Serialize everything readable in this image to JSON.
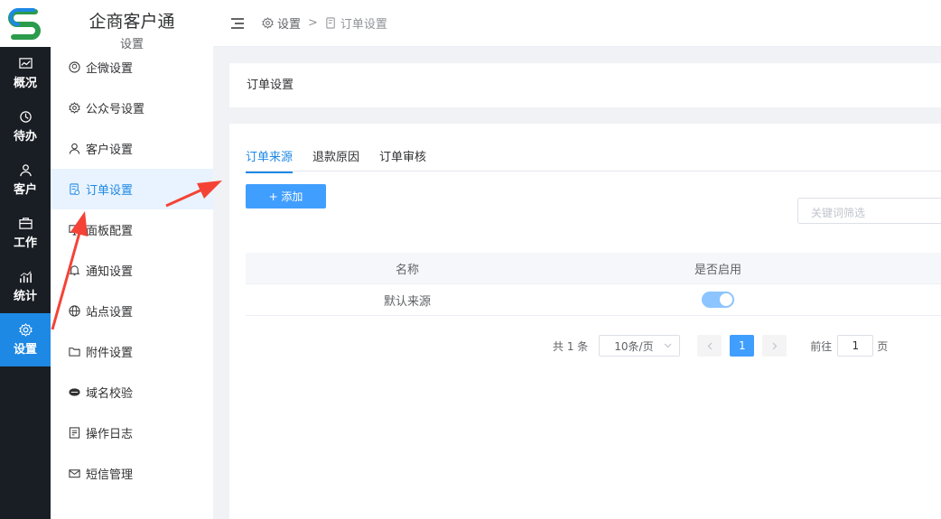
{
  "brand": {
    "title": "企商客户通",
    "subtitle": "设置",
    "logo_icon": "s-logo-icon"
  },
  "rail": [
    {
      "label": "概况",
      "icon": "chart-line-icon"
    },
    {
      "label": "待办",
      "icon": "clock-history-icon"
    },
    {
      "label": "客户",
      "icon": "user-icon"
    },
    {
      "label": "工作",
      "icon": "briefcase-icon"
    },
    {
      "label": "统计",
      "icon": "bar-chart-icon"
    },
    {
      "label": "设置",
      "icon": "gear-icon",
      "active": true
    }
  ],
  "sidebar": {
    "items": [
      {
        "label": "企微设置",
        "icon": "wecom-icon"
      },
      {
        "label": "公众号设置",
        "icon": "gear-outline-icon"
      },
      {
        "label": "客户设置",
        "icon": "user-outline-icon"
      },
      {
        "label": "订单设置",
        "icon": "order-doc-icon",
        "active": true
      },
      {
        "label": "面板配置",
        "icon": "monitor-icon"
      },
      {
        "label": "通知设置",
        "icon": "bell-icon"
      },
      {
        "label": "站点设置",
        "icon": "globe-icon"
      },
      {
        "label": "附件设置",
        "icon": "folder-icon"
      },
      {
        "label": "域名校验",
        "icon": "domain-badge-icon"
      },
      {
        "label": "操作日志",
        "icon": "log-icon"
      },
      {
        "label": "短信管理",
        "icon": "mail-icon"
      }
    ]
  },
  "header": {
    "breadcrumb": [
      "设置",
      "订单设置"
    ],
    "separator": ">"
  },
  "page": {
    "title": "订单设置",
    "tabs": [
      {
        "label": "订单来源",
        "active": true
      },
      {
        "label": "退款原因"
      },
      {
        "label": "订单审核"
      }
    ],
    "add_button": "+ 添加",
    "search_placeholder": "关键词筛选",
    "table": {
      "columns": [
        "名称",
        "是否启用"
      ],
      "rows": [
        {
          "name": "默认来源",
          "enabled": true
        }
      ]
    },
    "pagination": {
      "total_text": "共 1 条",
      "page_size": "10条/页",
      "current_page": "1",
      "goto_prefix": "前往",
      "goto_value": "1",
      "goto_suffix": "页"
    }
  },
  "colors": {
    "accent": "#1e88e5",
    "rail_bg": "#191d24",
    "annotation": "#f44336"
  }
}
